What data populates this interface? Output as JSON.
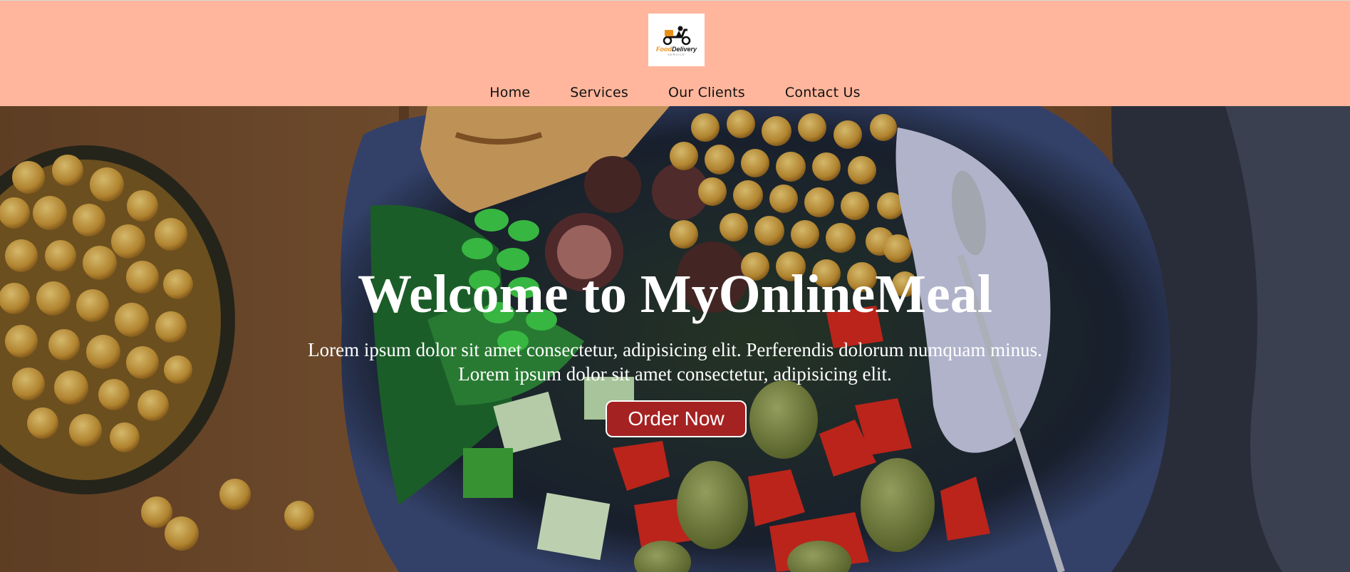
{
  "header": {
    "logo": {
      "brand_part1": "Food",
      "brand_part2": "Delivery",
      "tagline": "SERVICE"
    },
    "nav": [
      {
        "label": "Home"
      },
      {
        "label": "Services"
      },
      {
        "label": "Our Clients"
      },
      {
        "label": "Contact Us"
      }
    ]
  },
  "hero": {
    "title": "Welcome to MyOnlineMeal",
    "line1": "Lorem ipsum dolor sit amet consectetur, adipisicing elit. Perferendis dolorum numquam minus.",
    "line2": "Lorem ipsum dolor sit amet consectetur, adipisicing elit.",
    "button_label": "Order Now"
  },
  "colors": {
    "header_bg": "#ffb69c",
    "button_bg": "#a52222"
  }
}
